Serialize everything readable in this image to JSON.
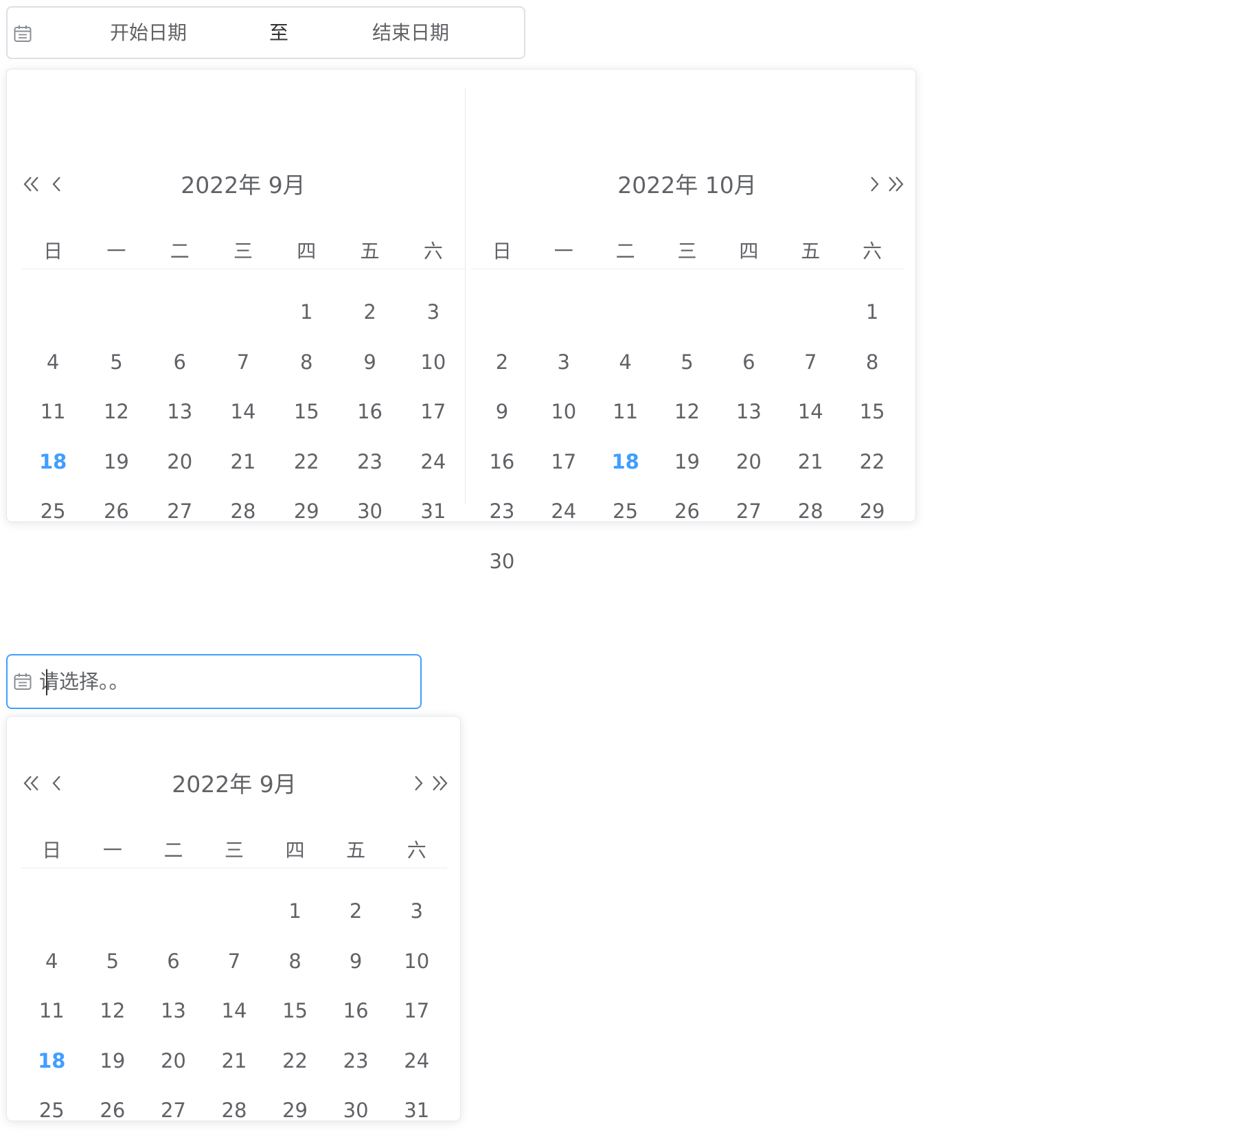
{
  "range_picker": {
    "start_placeholder": "开始日期",
    "separator": "至",
    "end_placeholder": "结束日期",
    "icon": "calendar-icon",
    "left_panel": {
      "title": "2022年 9月",
      "weekdays": [
        "日",
        "一",
        "二",
        "三",
        "四",
        "五",
        "六"
      ],
      "leading_blanks": 4,
      "days": [
        "1",
        "2",
        "3",
        "4",
        "5",
        "6",
        "7",
        "8",
        "9",
        "10",
        "11",
        "12",
        "13",
        "14",
        "15",
        "16",
        "17",
        "18",
        "19",
        "20",
        "21",
        "22",
        "23",
        "24",
        "25",
        "26",
        "27",
        "28",
        "29",
        "30",
        "31"
      ],
      "today": "18"
    },
    "right_panel": {
      "title": "2022年 10月",
      "weekdays": [
        "日",
        "一",
        "二",
        "三",
        "四",
        "五",
        "六"
      ],
      "leading_blanks": 6,
      "days": [
        "1",
        "2",
        "3",
        "4",
        "5",
        "6",
        "7",
        "8",
        "9",
        "10",
        "11",
        "12",
        "13",
        "14",
        "15",
        "16",
        "17",
        "18",
        "19",
        "20",
        "21",
        "22",
        "23",
        "24",
        "25",
        "26",
        "27",
        "28",
        "29",
        "30"
      ],
      "today": "18"
    }
  },
  "single_picker": {
    "placeholder": "请选择。。",
    "icon": "calendar-icon",
    "panel": {
      "title": "2022年 9月",
      "weekdays": [
        "日",
        "一",
        "二",
        "三",
        "四",
        "五",
        "六"
      ],
      "leading_blanks": 4,
      "days": [
        "1",
        "2",
        "3",
        "4",
        "5",
        "6",
        "7",
        "8",
        "9",
        "10",
        "11",
        "12",
        "13",
        "14",
        "15",
        "16",
        "17",
        "18",
        "19",
        "20",
        "21",
        "22",
        "23",
        "24",
        "25",
        "26",
        "27",
        "28",
        "29",
        "30",
        "31"
      ],
      "today": "18"
    }
  },
  "colors": {
    "accent": "#409eff",
    "text": "#606266",
    "border": "#dcdfe6"
  }
}
